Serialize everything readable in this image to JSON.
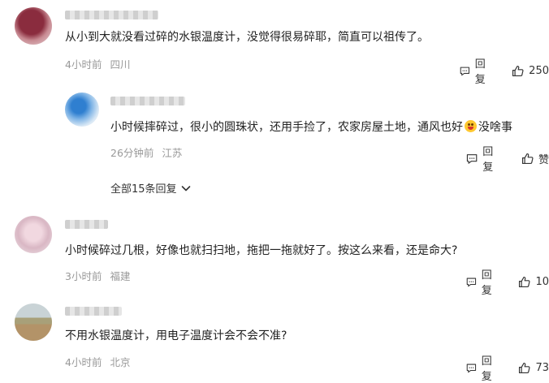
{
  "comments": [
    {
      "text": "从小到大就没看过碎的水银温度计，没觉得很易碎耶，简直可以祖传了。",
      "time": "4小时前",
      "location": "四川",
      "reply_label": "回复",
      "like_label": "250"
    },
    {
      "text": "小时候摔碎过，很小的圆珠状，还用手捡了，农家房屋土地，通风也好",
      "text_suffix": "没啥事",
      "time": "26分钟前",
      "location": "江苏",
      "reply_label": "回复",
      "like_label": "赞"
    },
    {
      "text": "小时候碎过几根，好像也就扫扫地，拖把一拖就好了。按这么来看，还是命大?",
      "time": "3小时前",
      "location": "福建",
      "reply_label": "回复",
      "like_label": "10"
    },
    {
      "text": "不用水银温度计，用电子温度计会不会不准?",
      "time": "4小时前",
      "location": "北京",
      "reply_label": "回复",
      "like_label": "73"
    }
  ],
  "expand_replies": "全部15条回复",
  "icons": {
    "reply": "comment-icon",
    "like": "thumbs-up-icon",
    "expand": "chevron-down-icon",
    "emoji": "grinning-face-icon"
  }
}
